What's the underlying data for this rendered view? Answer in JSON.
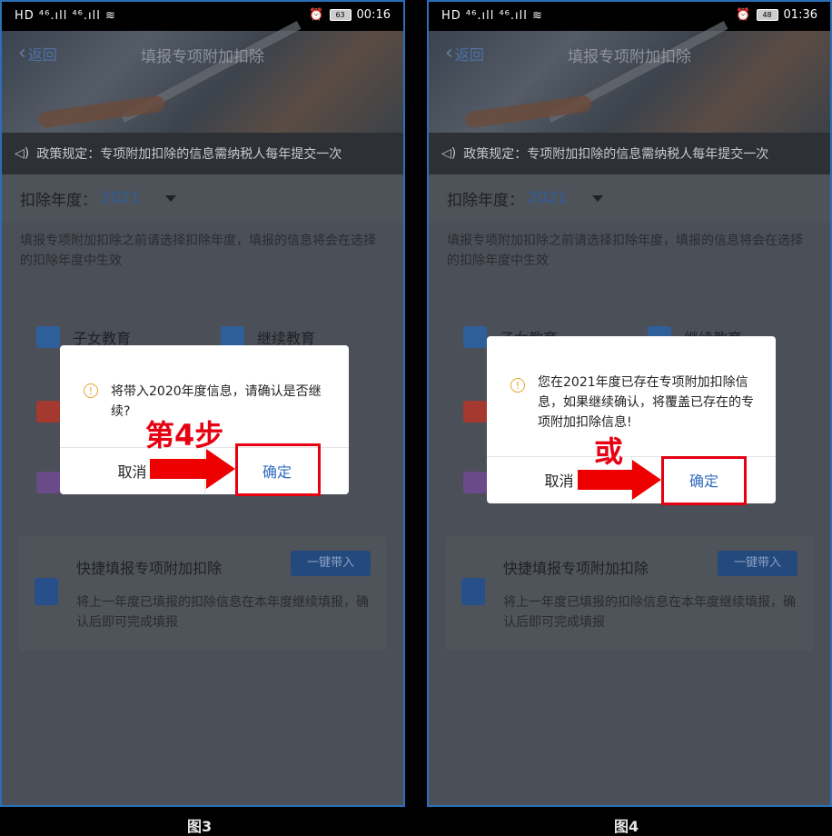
{
  "statusbar": {
    "left_icons": "HD ⁴⁶.ıll ⁴⁶.ıll ≋",
    "left_time": "00:16",
    "right_time": "01:36",
    "left_battery": "63",
    "right_battery": "48",
    "alarm": "⏰"
  },
  "nav": {
    "back_label": "返回",
    "title": "填报专项附加扣除"
  },
  "notice": "政策规定：专项附加扣除的信息需纳税人每年提交一次",
  "year": {
    "label": "扣除年度：",
    "value": "2021"
  },
  "description": "填报专项附加扣除之前请选择扣除年度，填报的信息将会在选择的扣除年度中生效",
  "categories": [
    {
      "label": "子女教育",
      "color": "#2f5f9a"
    },
    {
      "label": "继续教育",
      "color": "#2f5f9a"
    },
    {
      "label": "",
      "color": "#a5392f"
    },
    {
      "label": "",
      "color": "#6a4a88"
    }
  ],
  "quick": {
    "title": "快捷填报专项附加扣除",
    "button": "一键带入",
    "desc": "将上一年度已填报的扣除信息在本年度继续填报，确认后即可完成填报"
  },
  "dialog_left": {
    "message": "将带入2020年度信息，请确认是否继续?",
    "cancel": "取消",
    "ok": "确定"
  },
  "dialog_right": {
    "message": "您在2021年度已存在专项附加扣除信息，如果继续确认，将覆盖已存在的专项附加扣除信息!",
    "cancel": "取消",
    "ok": "确定"
  },
  "annotations": {
    "left_step": "第4步",
    "right_or": "或"
  },
  "captions": {
    "left": "图3",
    "right": "图4"
  },
  "colors": {
    "accent": "#2f6bc0",
    "highlight": "#e60012",
    "warn": "#e5a527"
  }
}
